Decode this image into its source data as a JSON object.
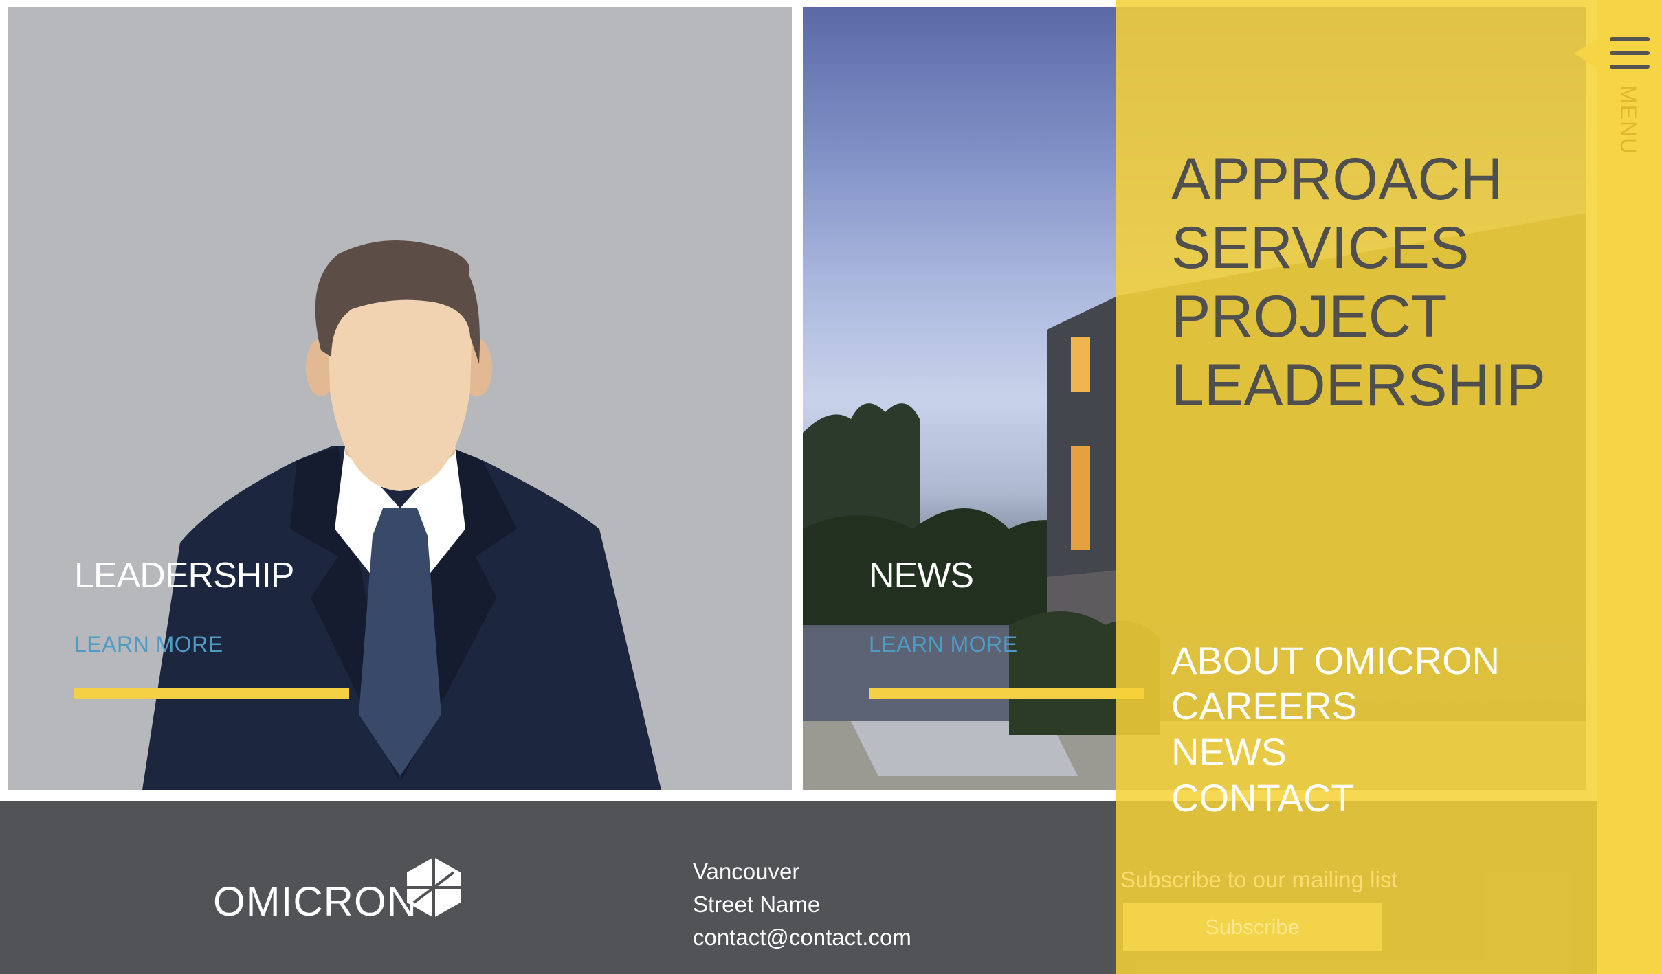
{
  "tiles": {
    "leadership": {
      "title": "LEADERSHIP",
      "link": "LEARN MORE"
    },
    "news": {
      "title": "NEWS",
      "link": "LEARN MORE"
    }
  },
  "footer": {
    "brand": "OMICRON",
    "address": [
      "Vancouver",
      "Street Name",
      "contact@contact.com"
    ]
  },
  "menu": {
    "toggle_label": "MENU",
    "primary": [
      "APPROACH",
      "SERVICES",
      "PROJECT",
      "LEADERSHIP"
    ],
    "secondary": [
      "ABOUT OMICRON",
      "CAREERS",
      "NEWS",
      "CONTACT"
    ],
    "subscribe_label": "Subscribe to our mailing list",
    "subscribe_button": "Subscribe"
  },
  "colors": {
    "accent_yellow": "#f6d044",
    "link_blue": "#4e9bc6",
    "footer_gray": "#525357"
  }
}
